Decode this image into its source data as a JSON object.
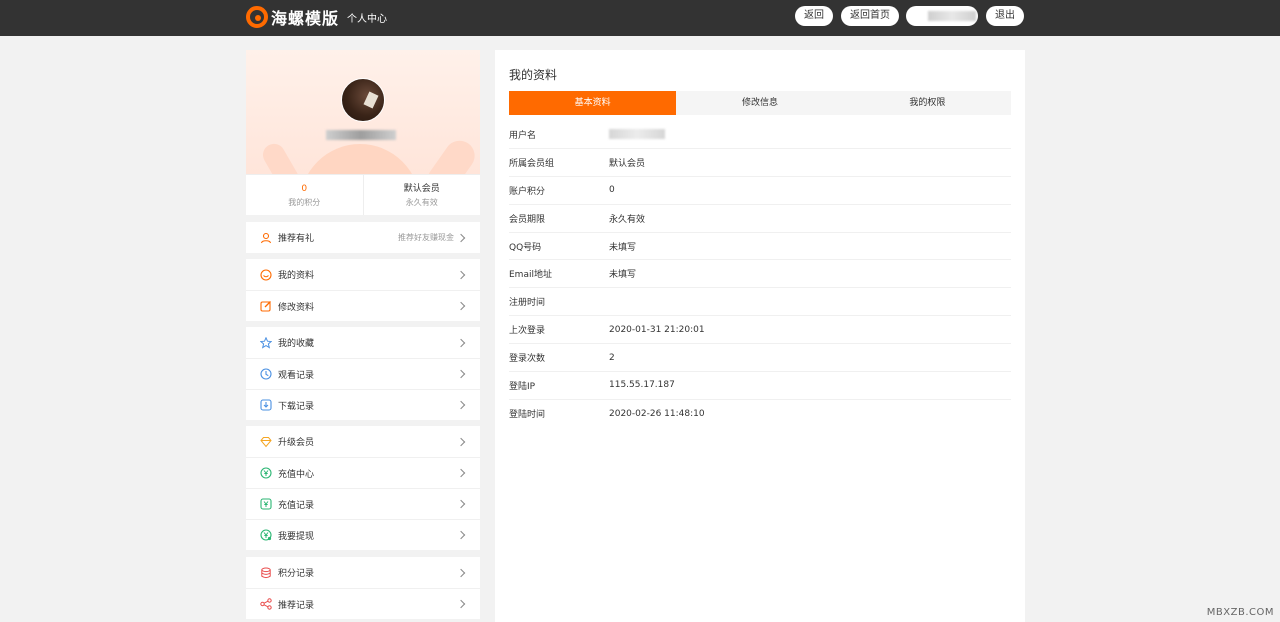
{
  "header": {
    "brand": "海螺模版",
    "subtitle": "个人中心",
    "buttons": {
      "back": "返回",
      "home": "返回首页",
      "logout": "退出"
    }
  },
  "profile": {
    "points_value": "0",
    "points_label": "我的积分",
    "member_value": "默认会员",
    "member_label": "永久有效"
  },
  "menu": {
    "referral": {
      "label": "推荐有礼",
      "extra": "推荐好友赚现金"
    },
    "group1": [
      {
        "label": "我的资料",
        "icon": "smile-icon"
      },
      {
        "label": "修改资料",
        "icon": "edit-icon"
      }
    ],
    "group2": [
      {
        "label": "我的收藏",
        "icon": "star-icon"
      },
      {
        "label": "观看记录",
        "icon": "clock-icon"
      },
      {
        "label": "下载记录",
        "icon": "download-icon"
      }
    ],
    "group3": [
      {
        "label": "升级会员",
        "icon": "diamond-icon"
      },
      {
        "label": "充值中心",
        "icon": "yen-circle-icon"
      },
      {
        "label": "充值记录",
        "icon": "yen-square-icon"
      },
      {
        "label": "我要提现",
        "icon": "withdraw-icon"
      }
    ],
    "group4": [
      {
        "label": "积分记录",
        "icon": "database-icon"
      },
      {
        "label": "推荐记录",
        "icon": "share-icon"
      }
    ]
  },
  "main": {
    "title": "我的资料",
    "tabs": [
      "基本资料",
      "修改信息",
      "我的权限"
    ],
    "rows": [
      {
        "key": "用户名",
        "value": ""
      },
      {
        "key": "所属会员组",
        "value": "默认会员"
      },
      {
        "key": "账户积分",
        "value": "0"
      },
      {
        "key": "会员期限",
        "value": "永久有效"
      },
      {
        "key": "QQ号码",
        "value": "未填写"
      },
      {
        "key": "Email地址",
        "value": "未填写"
      },
      {
        "key": "注册时间",
        "value": ""
      },
      {
        "key": "上次登录",
        "value": "2020-01-31 21:20:01"
      },
      {
        "key": "登录次数",
        "value": "2"
      },
      {
        "key": "登陆IP",
        "value": "115.55.17.187"
      },
      {
        "key": "登陆时间",
        "value": "2020-02-26 11:48:10"
      }
    ]
  },
  "watermark": "MBXZB.COM",
  "colors": {
    "accent": "#ff6a00",
    "topbar": "#333333",
    "background": "#f2f2f2"
  }
}
